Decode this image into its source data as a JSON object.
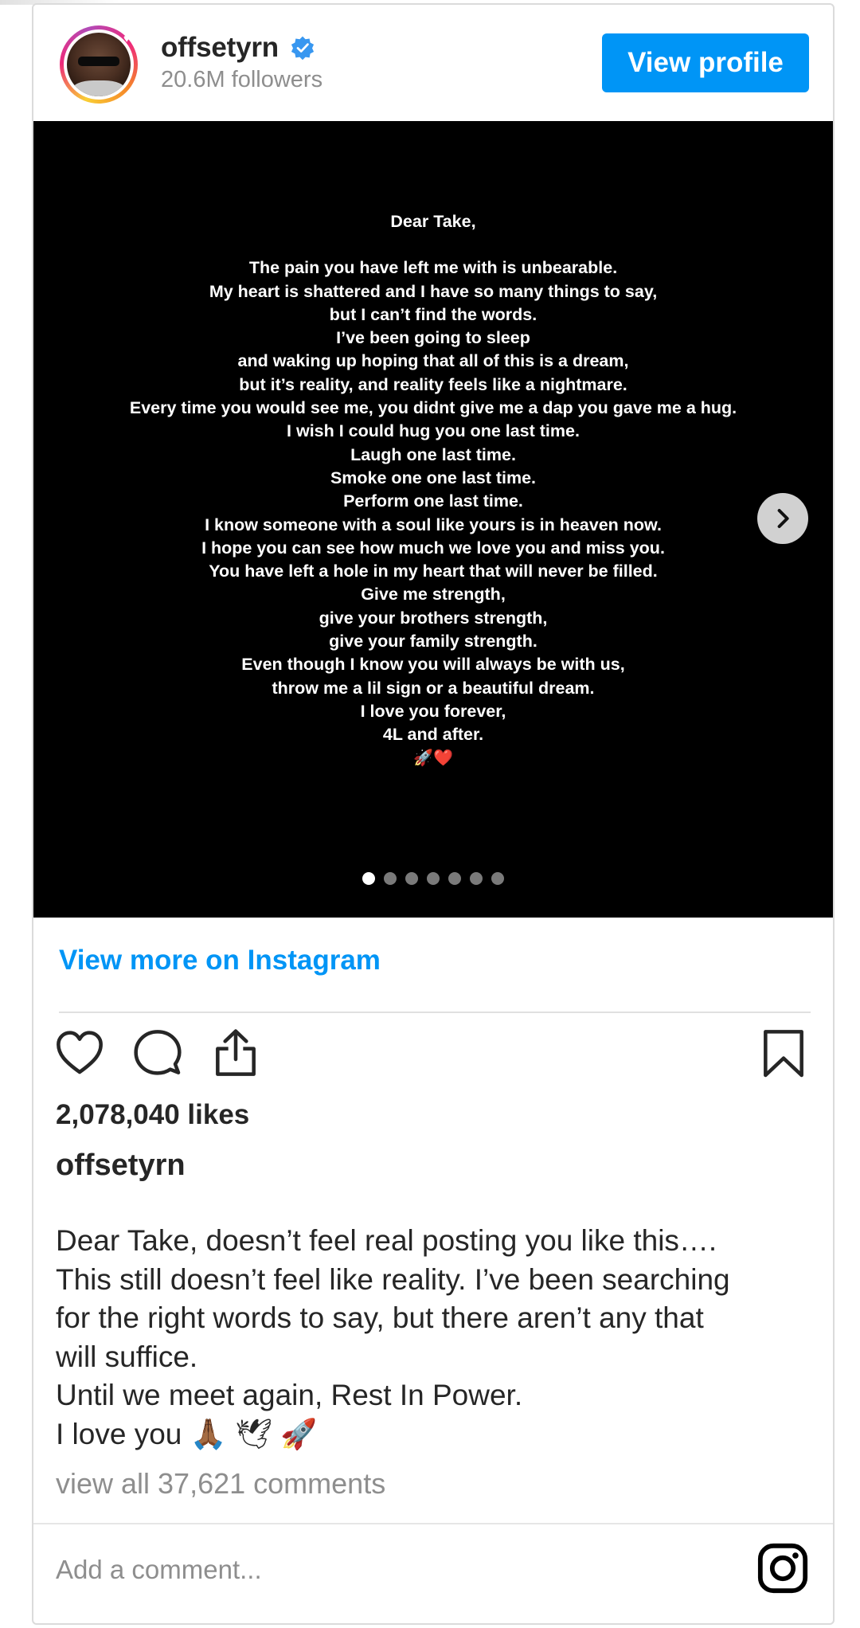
{
  "post": {
    "username": "offsetyrn",
    "followers": "20.6M followers",
    "view_profile_label": "View profile",
    "verified_icon": "verified-badge-icon"
  },
  "media": {
    "letter_lines": [
      "Dear Take,",
      "",
      "The pain you have left me with is unbearable.",
      "My heart is shattered and I have so many things to say,",
      "but I can’t find the words.",
      "I’ve been going to sleep",
      "and waking up hoping that all of this is a dream,",
      "but it’s reality, and reality feels like a nightmare.",
      "Every time you would see me, you didnt give me a dap you gave me a hug.",
      "I wish I could hug you one last time.",
      "Laugh one last time.",
      "Smoke one one last time.",
      "Perform one last time.",
      "I know someone with a soul like yours is in heaven now.",
      "I hope you can see how much we love you and miss you.",
      "You have left a hole in my heart that will never be filled.",
      "Give me strength,",
      "give your brothers strength,",
      "give your family strength.",
      "Even though I know you will always be with us,",
      "throw me a lil sign or a beautiful dream.",
      "I love you forever,",
      "4L and after."
    ],
    "emoji_line": "🚀❤️",
    "slide_count": 7,
    "active_slide": 1
  },
  "links": {
    "view_more": "View more on Instagram"
  },
  "engagement": {
    "likes": "2,078,040 likes"
  },
  "caption": {
    "username": "offsetyrn",
    "lines": [
      "Dear Take, doesn’t feel real posting you like this….",
      "This still doesn’t feel like reality. I’ve been searching",
      "for the right words to say, but there aren’t any that",
      "will suffice.",
      "Until we meet again, Rest In Power.",
      "I love you 🙏🏾 🕊 🚀"
    ],
    "view_comments": "view all 37,621 comments"
  },
  "comment_box": {
    "placeholder": "Add a comment..."
  },
  "colors": {
    "accent": "#0095f6",
    "text": "#262626",
    "muted": "#8e8e8e",
    "border": "#dbdbdb"
  }
}
